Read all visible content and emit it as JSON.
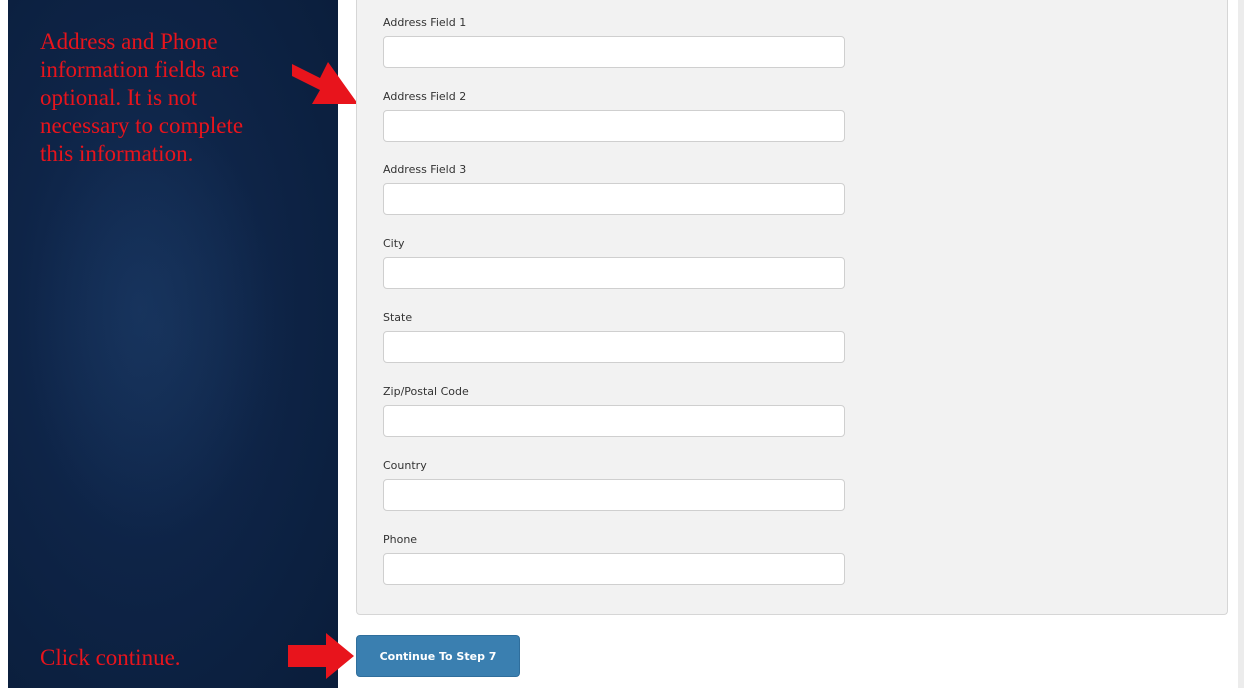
{
  "annotations": {
    "top_note": "Address and Phone information fields are optional. It is not necessary to complete this information.",
    "bottom_note": "Click continue."
  },
  "form": {
    "fields": [
      {
        "label": "Address Field 1",
        "value": ""
      },
      {
        "label": "Address Field 2",
        "value": ""
      },
      {
        "label": "Address Field 3",
        "value": ""
      },
      {
        "label": "City",
        "value": ""
      },
      {
        "label": "State",
        "value": ""
      },
      {
        "label": "Zip/Postal Code",
        "value": ""
      },
      {
        "label": "Country",
        "value": ""
      },
      {
        "label": "Phone",
        "value": ""
      }
    ]
  },
  "actions": {
    "continue_label": "Continue To Step 7"
  },
  "colors": {
    "annotation_red": "#e8141c",
    "panel_navy": "#0e2447",
    "button_blue": "#3a7fb0"
  },
  "icons": {
    "annotation_arrow": "red-arrow-icon"
  }
}
